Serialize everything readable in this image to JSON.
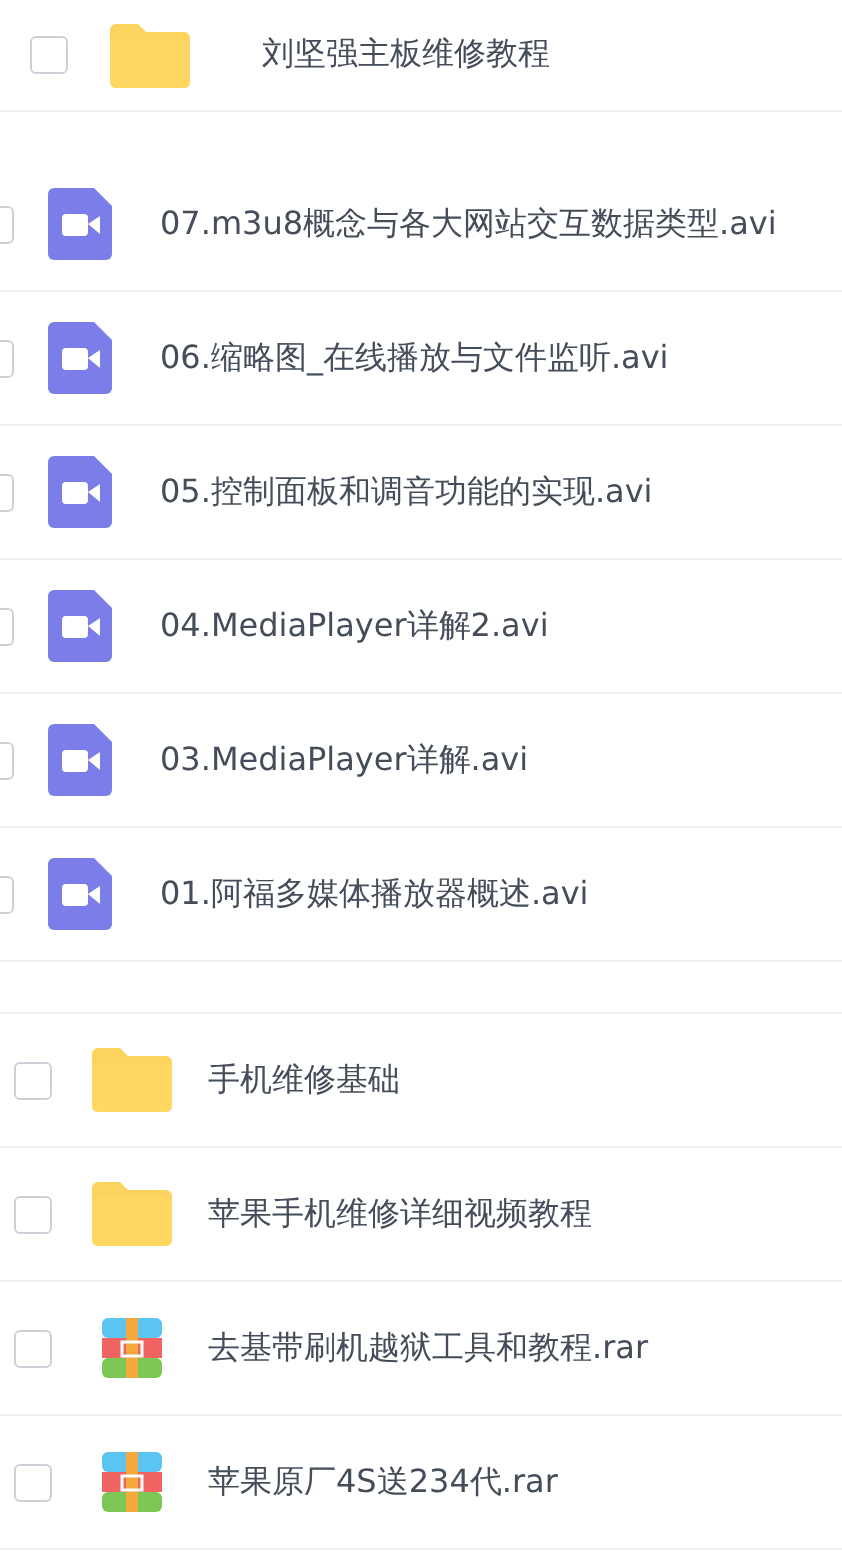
{
  "sections": [
    {
      "items": [
        {
          "kind": "folder",
          "name": "刘坚强主板维修教程",
          "checked": false
        }
      ]
    },
    {
      "items": [
        {
          "kind": "video",
          "name": "07.m3u8概念与各大网站交互数据类型.avi",
          "checked": false
        },
        {
          "kind": "video",
          "name": "06.缩略图_在线播放与文件监听.avi",
          "checked": false
        },
        {
          "kind": "video",
          "name": "05.控制面板和调音功能的实现.avi",
          "checked": false
        },
        {
          "kind": "video",
          "name": "04.MediaPlayer详解2.avi",
          "checked": false
        },
        {
          "kind": "video",
          "name": "03.MediaPlayer详解.avi",
          "checked": false
        },
        {
          "kind": "video",
          "name": "01.阿福多媒体播放器概述.avi",
          "checked": false
        }
      ]
    },
    {
      "items": [
        {
          "kind": "folder",
          "name": "手机维修基础",
          "checked": false
        },
        {
          "kind": "folder",
          "name": "苹果手机维修详细视频教程",
          "checked": false
        },
        {
          "kind": "archive",
          "name": "去基带刷机越狱工具和教程.rar",
          "checked": false
        },
        {
          "kind": "archive",
          "name": "苹果原厂4S送234代.rar",
          "checked": false
        }
      ]
    }
  ]
}
